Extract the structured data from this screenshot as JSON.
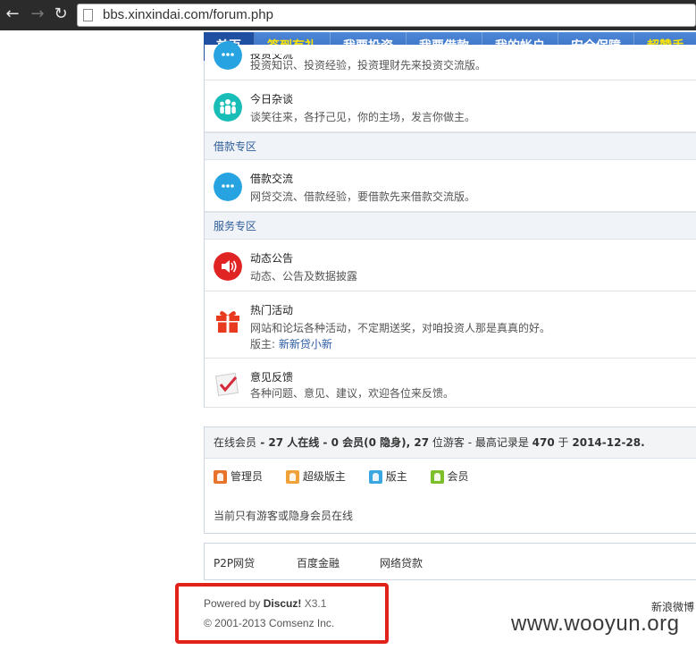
{
  "browser": {
    "url": "bbs.xinxindai.com/forum.php",
    "back_icon": "back-arrow-icon",
    "forward_icon": "forward-arrow-icon",
    "reload_icon": "reload-icon"
  },
  "topnav": {
    "items": [
      {
        "label": "首页"
      },
      {
        "label": "签到有礼"
      },
      {
        "label": "我要投资"
      },
      {
        "label": "我要借款"
      },
      {
        "label": "我的帐户"
      },
      {
        "label": "安全保障"
      },
      {
        "label": "超赞手"
      }
    ]
  },
  "forums_top": [
    {
      "title": "投资交流",
      "desc": "投资知识、投资经验，投资理财先来投资交流版。",
      "icon": "chat-bubbles-icon"
    },
    {
      "title": "今日杂谈",
      "desc": "谈笑往来，各抒己见，你的主场，发言你做主。",
      "icon": "people-group-icon"
    }
  ],
  "sections": [
    {
      "heading": "借款专区",
      "forums": [
        {
          "title": "借款交流",
          "desc": "网贷交流、借款经验，要借款先来借款交流版。",
          "icon": "chat-bubbles-icon"
        }
      ]
    },
    {
      "heading": "服务专区",
      "forums": [
        {
          "title": "动态公告",
          "desc": "动态、公告及数据披露",
          "icon": "speaker-icon"
        },
        {
          "title": "热门活动",
          "desc": "网站和论坛各种活动，不定期送奖，对咱投资人那是真真的好。",
          "moderator_label": "版主:",
          "moderator": "新新贷小新",
          "icon": "gift-icon"
        },
        {
          "title": "意见反馈",
          "desc": "各种问题、意见、建议，欢迎各位来反馈。",
          "icon": "checkmark-icon"
        }
      ]
    }
  ],
  "online": {
    "label": "在线会员",
    "sep": " - ",
    "total": "27",
    "total_suffix": " 人在线 - ",
    "members": "0",
    "members_suffix": " 会员(",
    "hidden": "0",
    "hidden_suffix": " 隐身), ",
    "guests": "27",
    "guests_suffix": " 位游客 - 最高记录是 ",
    "record": "470",
    "record_mid": " 于 ",
    "record_date": "2014-12-28.",
    "legend": [
      {
        "label": "管理员",
        "color": "#e8742c"
      },
      {
        "label": "超级版主",
        "color": "#f0a23a"
      },
      {
        "label": "版主",
        "color": "#3aa7e0"
      },
      {
        "label": "会员",
        "color": "#7cbf2a"
      }
    ],
    "current": "当前只有游客或隐身会员在线"
  },
  "links": [
    "P2P网贷",
    "百度金融",
    "网络贷款"
  ],
  "footer": {
    "powered_by": "Powered by ",
    "brand": "Discuz!",
    "version": " X3.1",
    "copyright": "© 2001-2013 Comsenz Inc.",
    "weibo": "新浪微博"
  },
  "watermark": "www.wooyun.org",
  "colors": {
    "nav_blue": "#2c63b8",
    "section_text": "#2f5d99",
    "highlight_red": "#e0221b"
  }
}
